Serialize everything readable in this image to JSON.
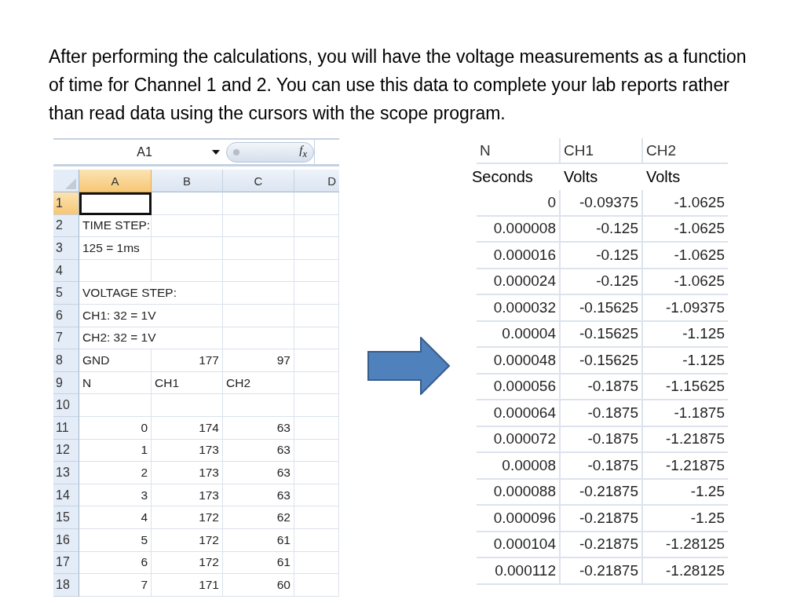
{
  "intro": "After performing the calculations, you  will have the voltage measurements as a function of time for Channel 1 and 2.  You can use this data to complete your lab reports rather than read data using the cursors with the scope program.",
  "sheet": {
    "name_box": "A1",
    "formula_label": "f$_{x}$",
    "columns": [
      {
        "label": "A",
        "selected": true
      },
      {
        "label": "B",
        "selected": false
      },
      {
        "label": "C",
        "selected": false
      },
      {
        "label": "D",
        "selected": false
      }
    ],
    "rows": [
      {
        "number": "1",
        "selected": true,
        "kind": "text",
        "cells": [
          "",
          "",
          ""
        ]
      },
      {
        "number": "2",
        "selected": false,
        "kind": "text",
        "cells": [
          "TIME STEP:",
          "",
          ""
        ]
      },
      {
        "number": "3",
        "selected": false,
        "kind": "text",
        "cells": [
          "125 = 1ms",
          "",
          ""
        ]
      },
      {
        "number": "4",
        "selected": false,
        "kind": "text",
        "cells": [
          "",
          "",
          ""
        ]
      },
      {
        "number": "5",
        "selected": false,
        "kind": "overflow",
        "cells": [
          "VOLTAGE STEP:",
          "",
          ""
        ]
      },
      {
        "number": "6",
        "selected": false,
        "kind": "overflow",
        "cells": [
          "CH1:  32 = 1V",
          "",
          ""
        ]
      },
      {
        "number": "7",
        "selected": false,
        "kind": "overflow",
        "cells": [
          "CH2:  32 = 1V",
          "",
          ""
        ]
      },
      {
        "number": "8",
        "selected": false,
        "kind": "mixed",
        "cells": [
          "GND",
          "177",
          "97"
        ]
      },
      {
        "number": "9",
        "selected": false,
        "kind": "text",
        "cells": [
          "N",
          "CH1",
          "CH2"
        ]
      },
      {
        "number": "10",
        "selected": false,
        "kind": "text",
        "cells": [
          "",
          "",
          ""
        ]
      },
      {
        "number": "11",
        "selected": false,
        "kind": "numbers",
        "cells": [
          "0",
          "174",
          "63"
        ]
      },
      {
        "number": "12",
        "selected": false,
        "kind": "numbers",
        "cells": [
          "1",
          "173",
          "63"
        ]
      },
      {
        "number": "13",
        "selected": false,
        "kind": "numbers",
        "cells": [
          "2",
          "173",
          "63"
        ]
      },
      {
        "number": "14",
        "selected": false,
        "kind": "numbers",
        "cells": [
          "3",
          "173",
          "63"
        ]
      },
      {
        "number": "15",
        "selected": false,
        "kind": "numbers",
        "cells": [
          "4",
          "172",
          "62"
        ]
      },
      {
        "number": "16",
        "selected": false,
        "kind": "numbers",
        "cells": [
          "5",
          "172",
          "61"
        ]
      },
      {
        "number": "17",
        "selected": false,
        "kind": "numbers",
        "cells": [
          "6",
          "172",
          "61"
        ]
      },
      {
        "number": "18",
        "selected": false,
        "kind": "numbers",
        "cells": [
          "7",
          "171",
          "60"
        ]
      }
    ]
  },
  "result": {
    "headers": [
      "N",
      "CH1",
      "CH2"
    ],
    "units": [
      "Seconds",
      "Volts",
      "Volts"
    ],
    "rows": [
      [
        "0",
        "-0.09375",
        "-1.0625"
      ],
      [
        "0.000008",
        "-0.125",
        "-1.0625"
      ],
      [
        "0.000016",
        "-0.125",
        "-1.0625"
      ],
      [
        "0.000024",
        "-0.125",
        "-1.0625"
      ],
      [
        "0.000032",
        "-0.15625",
        "-1.09375"
      ],
      [
        "0.00004",
        "-0.15625",
        "-1.125"
      ],
      [
        "0.000048",
        "-0.15625",
        "-1.125"
      ],
      [
        "0.000056",
        "-0.1875",
        "-1.15625"
      ],
      [
        "0.000064",
        "-0.1875",
        "-1.1875"
      ],
      [
        "0.000072",
        "-0.1875",
        "-1.21875"
      ],
      [
        "0.00008",
        "-0.1875",
        "-1.21875"
      ],
      [
        "0.000088",
        "-0.21875",
        "-1.25"
      ],
      [
        "0.000096",
        "-0.21875",
        "-1.25"
      ],
      [
        "0.000104",
        "-0.21875",
        "-1.28125"
      ],
      [
        "0.000112",
        "-0.21875",
        "-1.28125"
      ]
    ]
  }
}
